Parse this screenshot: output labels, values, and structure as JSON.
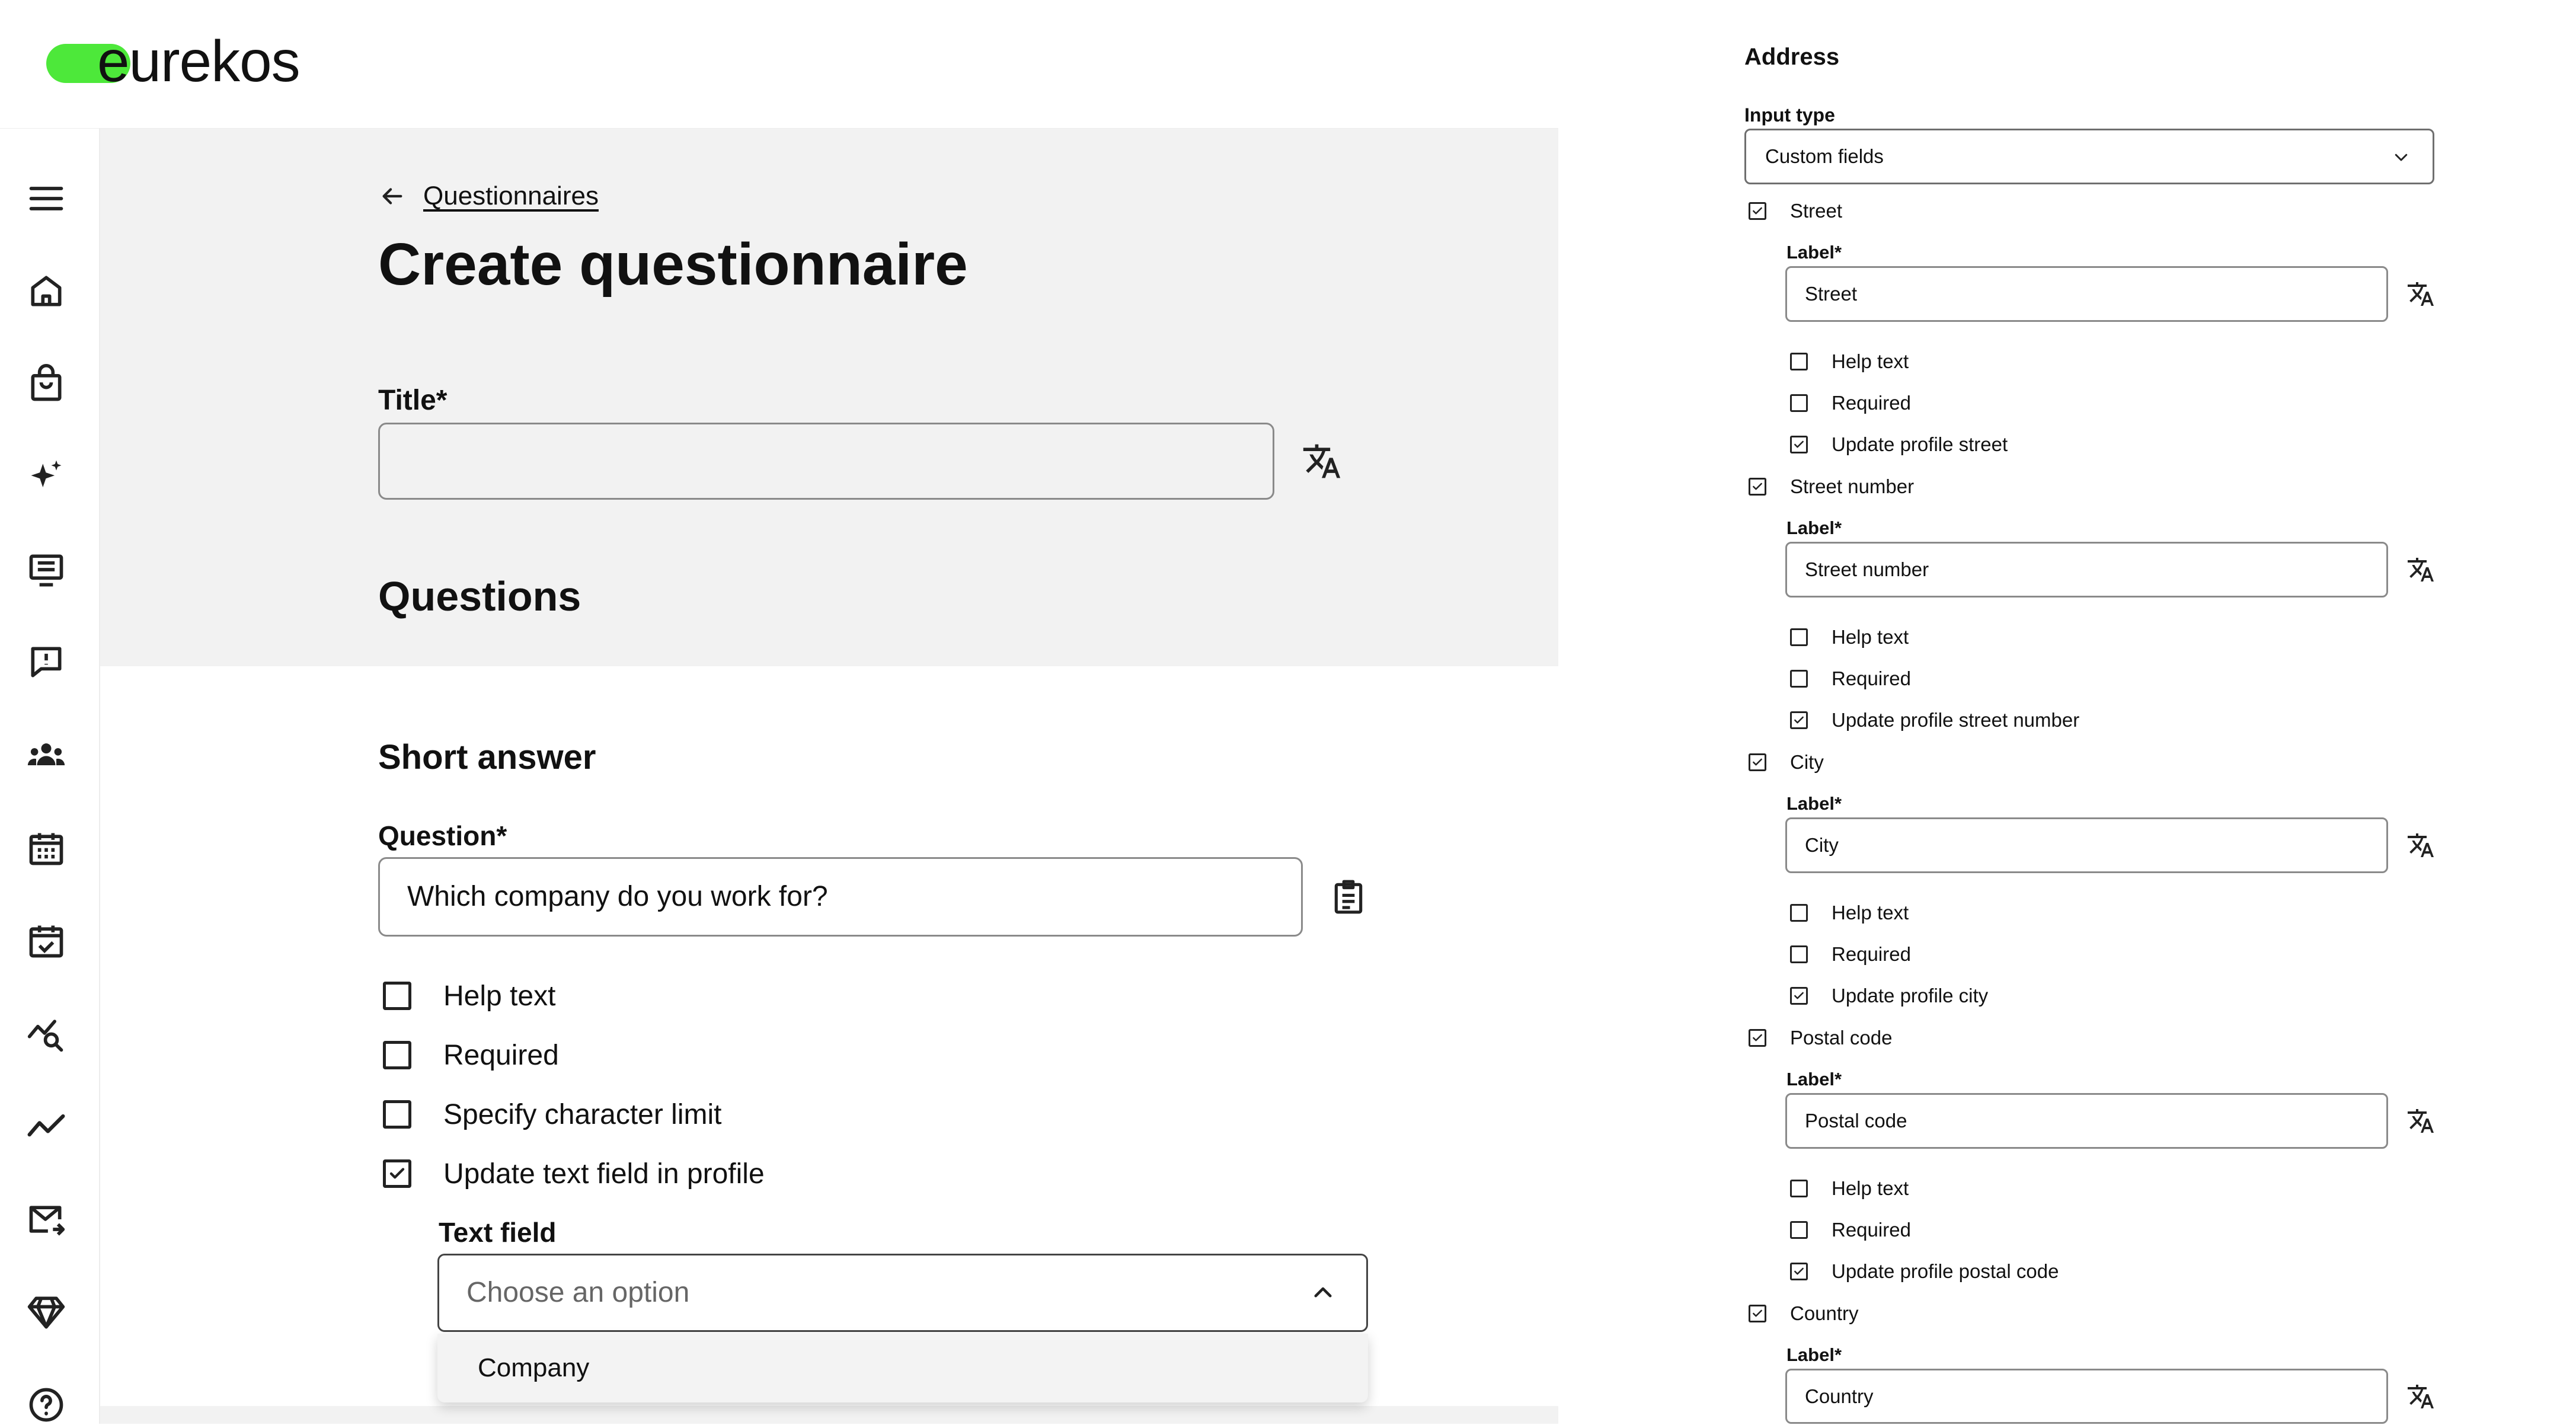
{
  "brand": {
    "name": "eurekos",
    "accent": "#4de83a"
  },
  "sidebar": {
    "icons": [
      "menu-icon",
      "home-icon",
      "shopping-bag-icon",
      "sparkle-icon",
      "list-card-icon",
      "alert-message-icon",
      "users-icon",
      "calendar-icon",
      "calendar-check-icon",
      "search-analytics-icon",
      "trend-line-icon",
      "mail-send-icon",
      "diamond-icon",
      "help-icon"
    ]
  },
  "breadcrumb": {
    "back_label": "Questionnaires"
  },
  "page": {
    "title": "Create questionnaire",
    "title_field_label": "Title*",
    "title_field_value": "",
    "questions_heading": "Questions"
  },
  "question": {
    "type_heading": "Short answer",
    "label": "Question*",
    "value": "Which company do you work for?",
    "options": [
      {
        "label": "Help text",
        "checked": false
      },
      {
        "label": "Required",
        "checked": false
      },
      {
        "label": "Specify character limit",
        "checked": false
      },
      {
        "label": "Update text field in profile",
        "checked": true
      }
    ],
    "text_field_label": "Text field",
    "text_field_placeholder": "Choose an option",
    "dropdown_options": [
      "Company"
    ]
  },
  "address": {
    "title": "Address",
    "input_type_label": "Input type",
    "input_type_value": "Custom fields",
    "label_caption": "Label*",
    "fields": [
      {
        "name": "Street",
        "checked": true,
        "label_value": "Street",
        "help_text": "Help text",
        "required": "Required",
        "update": "Update profile street"
      },
      {
        "name": "Street number",
        "checked": true,
        "label_value": "Street number",
        "help_text": "Help text",
        "required": "Required",
        "update": "Update profile street number"
      },
      {
        "name": "City",
        "checked": true,
        "label_value": "City",
        "help_text": "Help text",
        "required": "Required",
        "update": "Update profile city"
      },
      {
        "name": "Postal code",
        "checked": true,
        "label_value": "Postal code",
        "help_text": "Help text",
        "required": "Required",
        "update": "Update profile postal code"
      },
      {
        "name": "Country",
        "checked": true,
        "label_value": "Country"
      }
    ]
  }
}
